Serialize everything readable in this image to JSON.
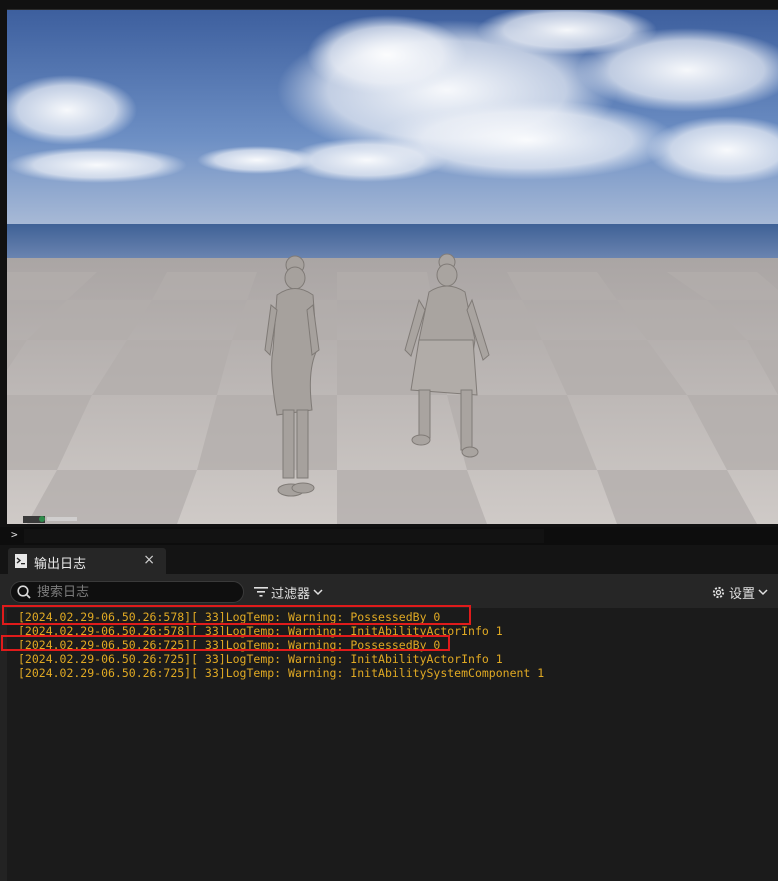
{
  "viewport": {
    "sky_color": "#5f7fb8",
    "floor_color": "#c9c4c1",
    "characters": [
      "character-left",
      "character-right"
    ]
  },
  "console": {
    "prompt": "> _"
  },
  "tab": {
    "label": "输出日志",
    "close": "×"
  },
  "toolbar": {
    "search_placeholder": "搜索日志",
    "filter_label": "过滤器",
    "settings_label": "设置"
  },
  "log": {
    "color": "#e0a923",
    "lines": [
      "[2024.02.29-06.50.26:578][ 33]LogTemp: Warning: PossessedBy 0",
      "[2024.02.29-06.50.26:578][ 33]LogTemp: Warning: InitAbilityActorInfo 1",
      "[2024.02.29-06.50.26:725][ 33]LogTemp: Warning: PossessedBy 0",
      "[2024.02.29-06.50.26:725][ 33]LogTemp: Warning: InitAbilityActorInfo 1",
      "[2024.02.29-06.50.26:725][ 33]LogTemp: Warning: InitAbilitySystemComponent 1"
    ]
  }
}
